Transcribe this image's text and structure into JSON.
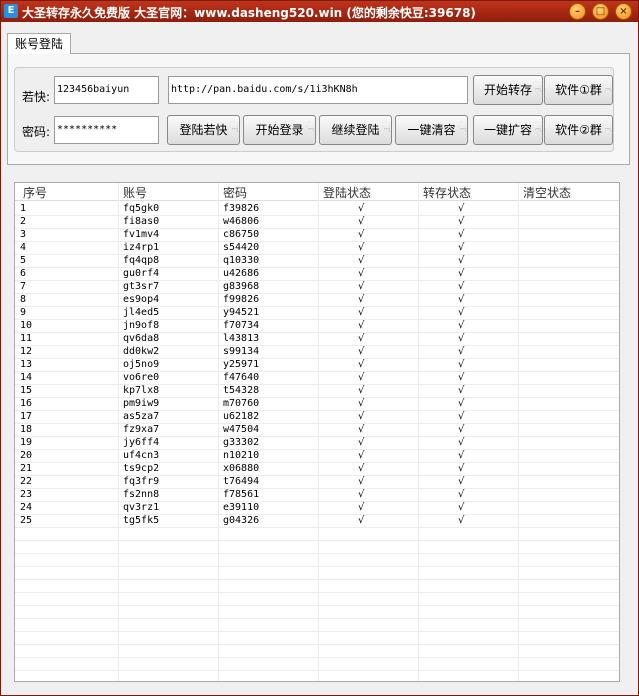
{
  "window": {
    "title": "大圣转存永久免费版  大圣官网：www.dasheng520.win  (您的剩余快豆:39678)",
    "icon": "app-icon",
    "controls": [
      "minimize",
      "maximize",
      "close"
    ]
  },
  "tab": {
    "label": "账号登陆"
  },
  "form": {
    "account_label": "若快:",
    "account_value": "123456baiyun",
    "password_label": "密码:",
    "password_value": "**********",
    "url_value": "http://pan.baidu.com/s/1i3hKN8h"
  },
  "buttons": {
    "start_transfer": "开始转存",
    "group1": "软件①群",
    "login_ruokuai": "登陆若快",
    "start_login": "开始登录",
    "continue_login": "继续登陆",
    "clear_all": "一键清容",
    "expand_all": "一键扩容",
    "group2": "软件②群"
  },
  "table": {
    "columns": [
      "序号",
      "账号",
      "密码",
      "登陆状态",
      "转存状态",
      "清空状态"
    ],
    "check_mark": "√",
    "rows": [
      [
        "1",
        "fq5gk0",
        "f39826",
        "√",
        "√",
        ""
      ],
      [
        "2",
        "fi8as0",
        "w46806",
        "√",
        "√",
        ""
      ],
      [
        "3",
        "fv1mv4",
        "c86750",
        "√",
        "√",
        ""
      ],
      [
        "4",
        "iz4rp1",
        "s54420",
        "√",
        "√",
        ""
      ],
      [
        "5",
        "fq4qp8",
        "q10330",
        "√",
        "√",
        ""
      ],
      [
        "6",
        "gu0rf4",
        "u42686",
        "√",
        "√",
        ""
      ],
      [
        "7",
        "gt3sr7",
        "g83968",
        "√",
        "√",
        ""
      ],
      [
        "8",
        "es9op4",
        "f99826",
        "√",
        "√",
        ""
      ],
      [
        "9",
        "jl4ed5",
        "y94521",
        "√",
        "√",
        ""
      ],
      [
        "10",
        "jn9of8",
        "f70734",
        "√",
        "√",
        ""
      ],
      [
        "11",
        "qv6da8",
        "l43813",
        "√",
        "√",
        ""
      ],
      [
        "12",
        "dd0kw2",
        "s99134",
        "√",
        "√",
        ""
      ],
      [
        "13",
        "oj5no9",
        "y25971",
        "√",
        "√",
        ""
      ],
      [
        "14",
        "vo6re0",
        "f47640",
        "√",
        "√",
        ""
      ],
      [
        "15",
        "kp7lx8",
        "t54328",
        "√",
        "√",
        ""
      ],
      [
        "16",
        "pm9iw9",
        "m70760",
        "√",
        "√",
        ""
      ],
      [
        "17",
        "as5za7",
        "u62182",
        "√",
        "√",
        ""
      ],
      [
        "18",
        "fz9xa7",
        "w47504",
        "√",
        "√",
        ""
      ],
      [
        "19",
        "jy6ff4",
        "g33302",
        "√",
        "√",
        ""
      ],
      [
        "20",
        "uf4cn3",
        "n10210",
        "√",
        "√",
        ""
      ],
      [
        "21",
        "ts9cp2",
        "x06880",
        "√",
        "√",
        ""
      ],
      [
        "22",
        "fq3fr9",
        "t76494",
        "√",
        "√",
        ""
      ],
      [
        "23",
        "fs2nn8",
        "f78561",
        "√",
        "√",
        ""
      ],
      [
        "24",
        "qv3rz1",
        "e39110",
        "√",
        "√",
        ""
      ],
      [
        "25",
        "tg5fk5",
        "g04326",
        "√",
        "√",
        ""
      ]
    ]
  }
}
